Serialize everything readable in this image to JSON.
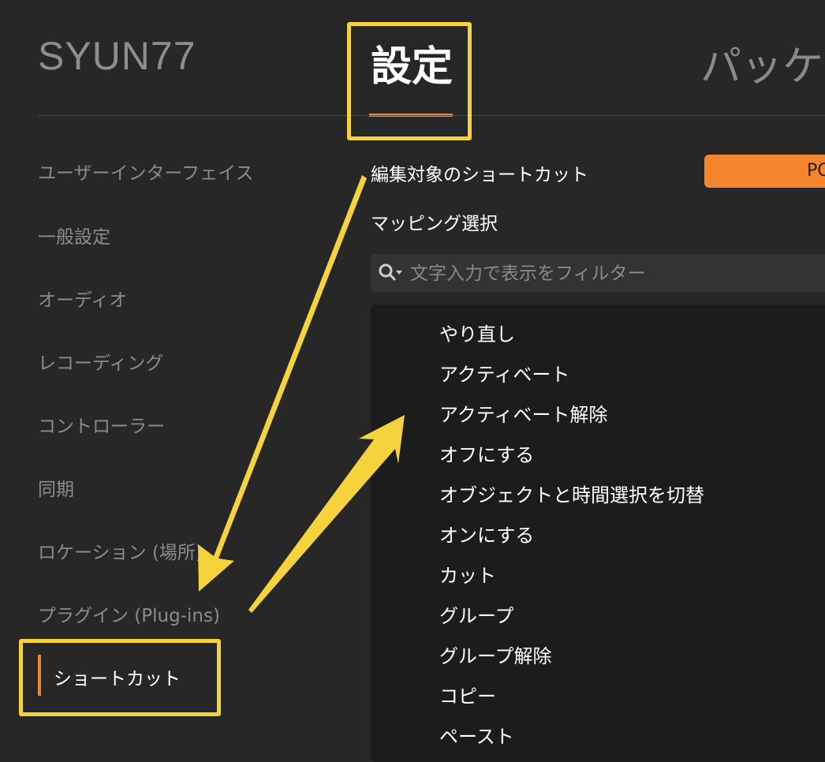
{
  "header": {
    "app_title": "SYUN77",
    "tabs": [
      {
        "label": "設定",
        "active": true
      },
      {
        "label": "パッケ",
        "active": false
      }
    ]
  },
  "sidebar": {
    "items": [
      {
        "label": "ユーザーインターフェイス"
      },
      {
        "label": "一般設定"
      },
      {
        "label": "オーディオ"
      },
      {
        "label": "レコーディング"
      },
      {
        "label": "コントローラー"
      },
      {
        "label": "同期"
      },
      {
        "label": "ロケーション (場所)"
      },
      {
        "label": "プラグイン (Plug-ins)"
      },
      {
        "label": "ショートカット",
        "active": true
      }
    ]
  },
  "main": {
    "edit_target_label": "編集対象のショートカット",
    "mapping_label": "マッピング選択",
    "mapping_button_label": "PC",
    "search": {
      "placeholder": "文字入力で表示をフィルター",
      "value": ""
    },
    "shortcuts": [
      "やり直し",
      "アクティベート",
      "アクティベート解除",
      "オフにする",
      "オブジェクトと時間選択を切替",
      "オンにする",
      "カット",
      "グループ",
      "グループ解除",
      "コピー",
      "ペースト"
    ]
  },
  "colors": {
    "background": "#272727",
    "accent": "#f5852c",
    "annotation": "#f6d33d",
    "list_background": "#1c1c1c"
  },
  "icons": {
    "search": "search-icon",
    "dropdown": "caret-down-icon"
  }
}
